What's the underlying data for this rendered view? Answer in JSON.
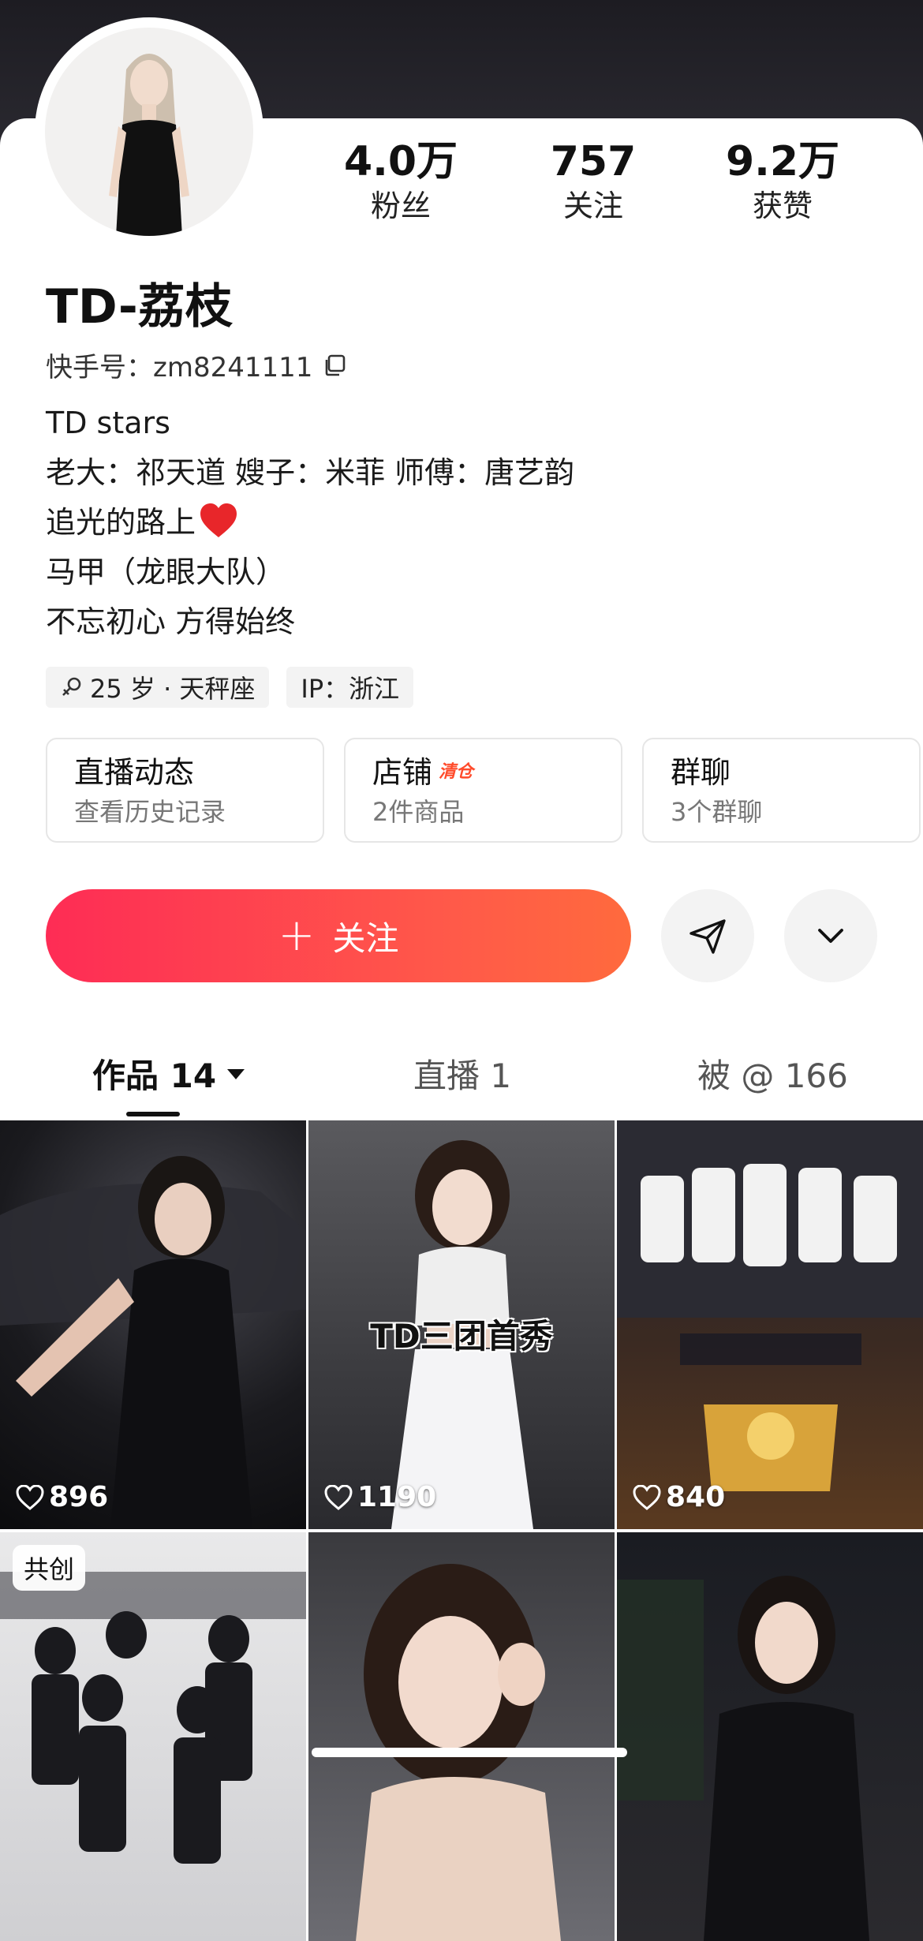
{
  "profile": {
    "name": "TD-荔枝",
    "kuaishou_id": "快手号：zm8241111",
    "bio_lines": [
      "TD stars",
      "老大：祁天道 嫂子：米菲 师傅：唐艺韵",
      "追光的路上",
      "马甲（龙眼大队）",
      "不忘初心 方得始终"
    ],
    "tags": {
      "age": "25 岁 · 天秤座",
      "ip": "IP：浙江"
    }
  },
  "stats": [
    {
      "num": "4.0万",
      "label": "粉丝"
    },
    {
      "num": "757",
      "label": "关注"
    },
    {
      "num": "9.2万",
      "label": "获赞"
    }
  ],
  "cards": [
    {
      "title": "直播动态",
      "sub": "查看历史记录"
    },
    {
      "title": "店铺",
      "badge": "清仓",
      "sub": "2件商品"
    },
    {
      "title": "群聊",
      "sub": "3个群聊"
    }
  ],
  "actions": {
    "follow": "关注"
  },
  "tabs": [
    {
      "label": "作品 14"
    },
    {
      "label": "直播 1"
    },
    {
      "label": "被 @ 166"
    }
  ],
  "videos": [
    {
      "likes": "896"
    },
    {
      "likes": "1190",
      "overlay": "TD三团首秀"
    },
    {
      "likes": "840"
    },
    {
      "corner": "共创"
    },
    {},
    {}
  ],
  "colors": {
    "accent": "#fe2c55",
    "accent_end": "#ff6a3d",
    "header": "#1d1c22"
  },
  "icons": [
    "copy-icon",
    "gender-female-icon",
    "heart-icon",
    "send-icon",
    "chevron-down-icon",
    "plus-icon",
    "caret-down-icon"
  ]
}
